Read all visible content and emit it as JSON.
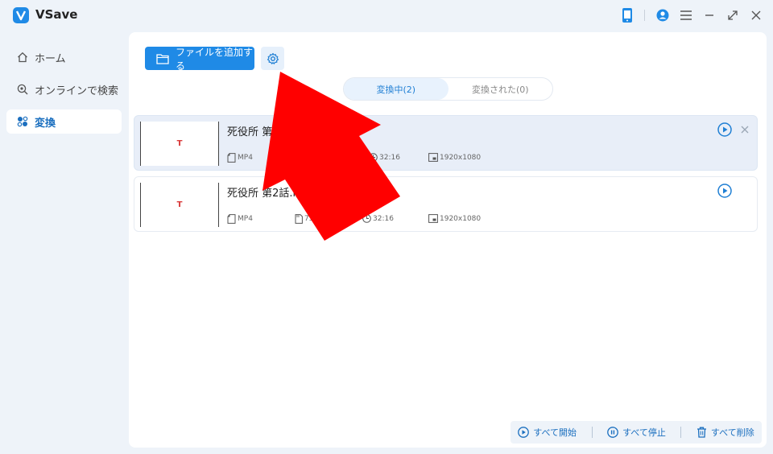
{
  "app": {
    "title": "VSave",
    "brand_color": "#1f8ae6"
  },
  "titlebar": {
    "icons": [
      "phone-icon",
      "account-icon",
      "menu-icon",
      "minimize-icon",
      "maximize-icon",
      "close-icon"
    ]
  },
  "sidebar": {
    "items": [
      {
        "label": "ホーム",
        "icon": "home-icon",
        "active": false
      },
      {
        "label": "オンラインで検索",
        "icon": "search-icon",
        "active": false
      },
      {
        "label": "変換",
        "icon": "convert-icon",
        "active": true
      }
    ]
  },
  "toolbar": {
    "add_files_label": "ファイルを追加する",
    "settings_icon": "gear-icon"
  },
  "tabs": [
    {
      "label": "変換中(2)",
      "active": true
    },
    {
      "label": "変換された(0)",
      "active": false
    }
  ],
  "files": [
    {
      "name": "死役所 第",
      "format": "MP4",
      "size": "",
      "duration": "32:16",
      "resolution": "1920x1080",
      "thumb_mark": "T"
    },
    {
      "name": "死役所 第2話.m",
      "format": "MP4",
      "size": "75",
      "duration": "32:16",
      "resolution": "1920x1080",
      "thumb_mark": "T"
    }
  ],
  "bottom_actions": {
    "start_all": "すべて開始",
    "stop_all": "すべて停止",
    "delete_all": "すべて削除"
  },
  "annotation": {
    "arrow_color": "#ff0000"
  }
}
